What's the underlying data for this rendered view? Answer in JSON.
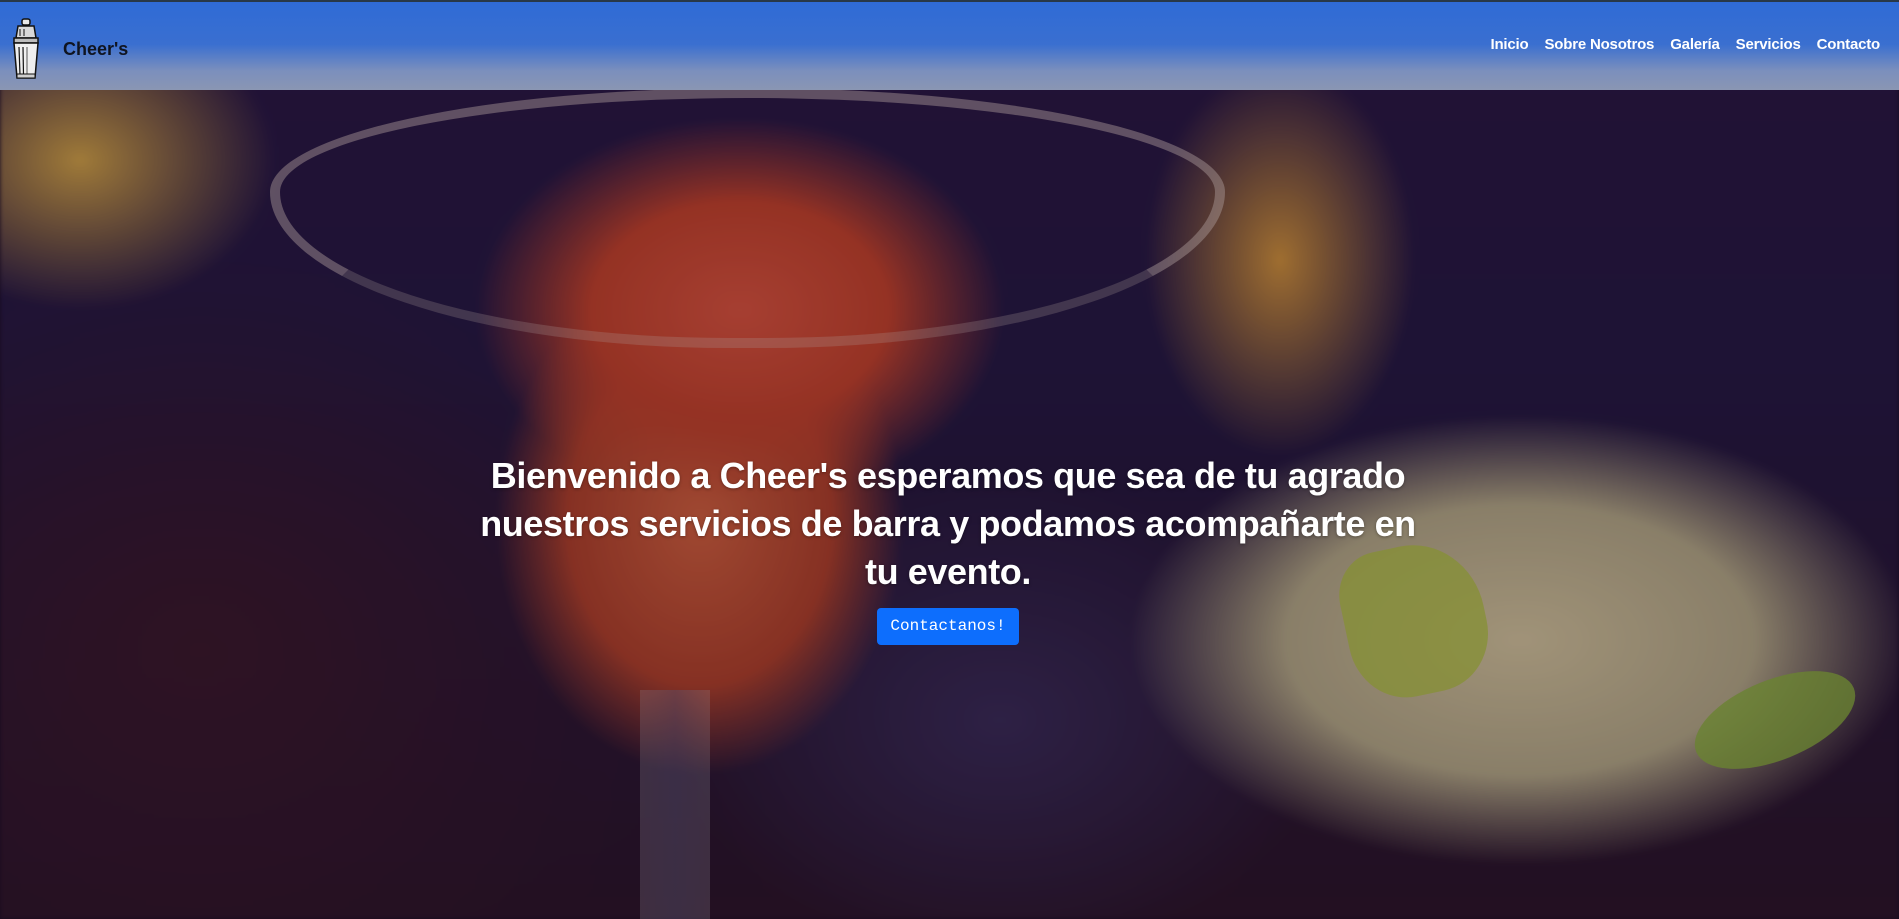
{
  "navbar": {
    "brand": {
      "name": "Cheer's",
      "logo_icon": "cocktail-shaker-icon"
    },
    "links": [
      {
        "label": "Inicio"
      },
      {
        "label": "Sobre Nosotros"
      },
      {
        "label": "Galería"
      },
      {
        "label": "Servicios"
      },
      {
        "label": "Contacto"
      }
    ],
    "colors": {
      "background": "#3a6fd0",
      "link_text": "#ffffff",
      "brand_text": "#0f1420"
    }
  },
  "hero": {
    "title": "Bienvenido a Cheer's esperamos que sea de tu agrado nuestros servicios de barra y podamos acompañarte en tu evento.",
    "cta_label": "Contactanos!",
    "cta_color": "#0d6efd",
    "background_image": "cocktail-glasses-photo"
  }
}
